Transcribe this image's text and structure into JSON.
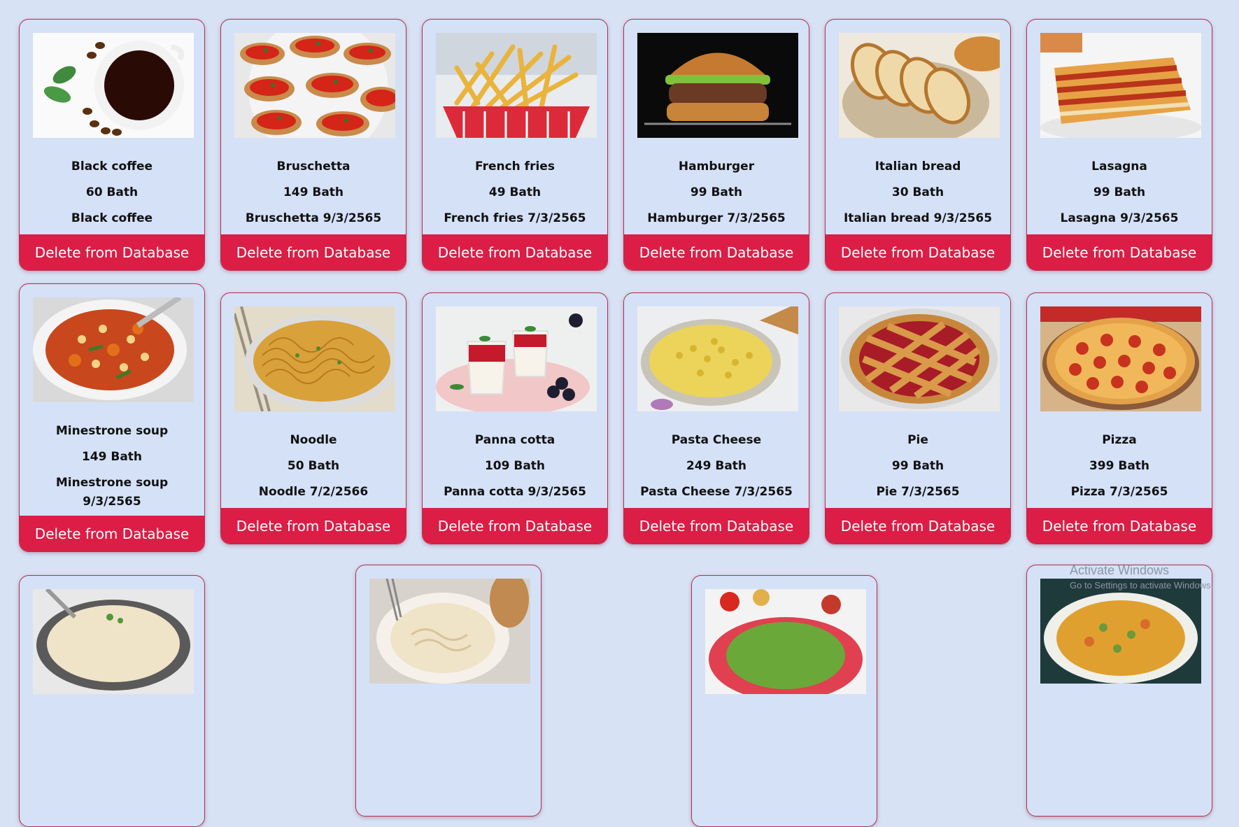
{
  "colors": {
    "background": "#d8e2f5",
    "card": "#d5e1f7",
    "border": "#b0304a",
    "delete_button": "#dc1d45"
  },
  "delete_label": "Delete from Database",
  "items": [
    {
      "name": "Black coffee",
      "price": "60 Bath",
      "desc": "Black coffee",
      "icon": "coffee-cup-image"
    },
    {
      "name": "Bruschetta",
      "price": "149 Bath",
      "desc": "Bruschetta 9/3/2565",
      "icon": "bruschetta-image"
    },
    {
      "name": "French fries",
      "price": "49 Bath",
      "desc": "French fries 7/3/2565",
      "icon": "french-fries-image"
    },
    {
      "name": "Hamburger",
      "price": "99 Bath",
      "desc": "Hamburger 7/3/2565",
      "icon": "hamburger-image"
    },
    {
      "name": "Italian bread",
      "price": "30 Bath",
      "desc": "Italian bread 9/3/2565",
      "icon": "bread-image"
    },
    {
      "name": "Lasagna",
      "price": "99 Bath",
      "desc": "Lasagna 9/3/2565",
      "icon": "lasagna-image"
    },
    {
      "name": "Minestrone soup",
      "price": "149 Bath",
      "desc": "Minestrone soup 9/3/2565",
      "icon": "soup-image"
    },
    {
      "name": "Noodle",
      "price": "50 Bath",
      "desc": "Noodle 7/2/2566",
      "icon": "noodle-image"
    },
    {
      "name": "Panna cotta",
      "price": "109 Bath",
      "desc": "Panna cotta 9/3/2565",
      "icon": "panna-cotta-image"
    },
    {
      "name": "Pasta Cheese",
      "price": "249 Bath",
      "desc": "Pasta Cheese 7/3/2565",
      "icon": "pasta-cheese-image"
    },
    {
      "name": "Pie",
      "price": "99 Bath",
      "desc": "Pie 7/3/2565",
      "icon": "pie-image"
    },
    {
      "name": "Pizza",
      "price": "399 Bath",
      "desc": "Pizza 7/3/2565",
      "icon": "pizza-image"
    },
    {
      "icon": "risotto-image"
    },
    {
      "icon": "pasta-bowl-image"
    },
    {
      "icon": "salad-image"
    },
    {
      "icon": "vegetable-soup-image"
    }
  ],
  "watermark": {
    "title": "Activate Windows",
    "subtitle": "Go to Settings to activate Windows."
  }
}
